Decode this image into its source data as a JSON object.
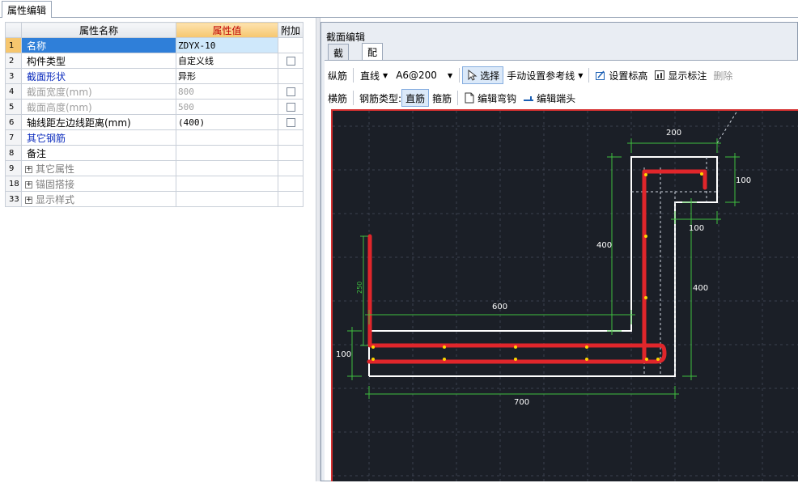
{
  "top_tab": "属性编辑",
  "prop_table": {
    "headers": {
      "name": "属性名称",
      "value": "属性值",
      "extra": "附加"
    },
    "rows": [
      {
        "idx": "1",
        "name": "名称",
        "value": "ZDYX-10",
        "check": false,
        "style": "sel"
      },
      {
        "idx": "2",
        "name": "构件类型",
        "value": "自定义线",
        "check": true,
        "style": ""
      },
      {
        "idx": "3",
        "name": "截面形状",
        "value": "异形",
        "check": false,
        "style": "blue"
      },
      {
        "idx": "4",
        "name": "截面宽度(mm)",
        "value": "800",
        "check": true,
        "style": "gray"
      },
      {
        "idx": "5",
        "name": "截面高度(mm)",
        "value": "500",
        "check": true,
        "style": "gray"
      },
      {
        "idx": "6",
        "name": "轴线距左边线距离(mm)",
        "value": "(400)",
        "check": true,
        "style": ""
      },
      {
        "idx": "7",
        "name": "其它钢筋",
        "value": "",
        "check": false,
        "style": "blue"
      },
      {
        "idx": "8",
        "name": "备注",
        "value": "",
        "check": false,
        "style": ""
      },
      {
        "idx": "9",
        "name": "其它属性",
        "value": "",
        "check": false,
        "style": "grp"
      },
      {
        "idx": "18",
        "name": "锚固搭接",
        "value": "",
        "check": false,
        "style": "grp"
      },
      {
        "idx": "33",
        "name": "显示样式",
        "value": "",
        "check": false,
        "style": "grp"
      }
    ]
  },
  "panel": {
    "title": "截面编辑",
    "tabs": [
      "截面",
      "配筋"
    ],
    "active_tab": "配筋",
    "toolbar1": {
      "longitudinal": "纵筋",
      "line_type": "直线",
      "rebar_spec": "A6@200",
      "select": "选择",
      "manual_ref": "手动设置参考线",
      "set_elevation": "设置标高",
      "show_dimensions": "显示标注",
      "delete": "删除"
    },
    "toolbar2": {
      "transverse": "横筋",
      "rebar_type_label": "钢筋类型:",
      "straight": "直筋",
      "stirrup": "箍筋",
      "edit_hook": "编辑弯钩",
      "edit_end": "编辑端头"
    }
  },
  "drawing": {
    "dims": {
      "top_width": "200",
      "right_top_height": "100",
      "notch_width": "100",
      "inner_height": "400",
      "outer_height": "400",
      "left_width": "600",
      "bottom_height": "100",
      "total_width": "700",
      "rebar_length": "250"
    },
    "colors": {
      "background": "#1b1f27",
      "outline": "#ffffff",
      "rebar": "#e0262b",
      "dimension": "#3fbf3f",
      "point": "#ffd400"
    }
  }
}
